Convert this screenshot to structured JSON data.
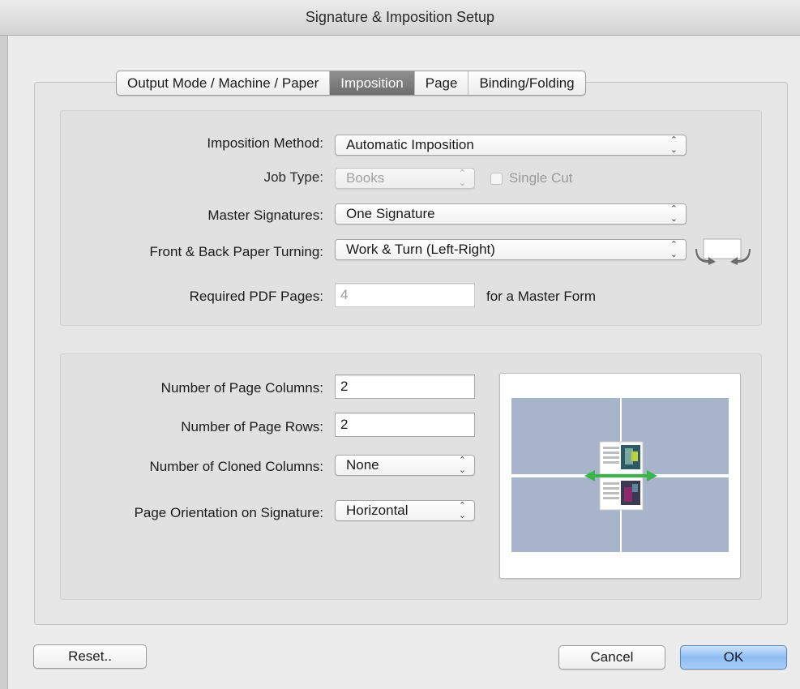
{
  "window": {
    "title": "Signature & Imposition Setup"
  },
  "tabs": [
    {
      "label": "Output Mode / Machine / Paper",
      "active": false
    },
    {
      "label": "Imposition",
      "active": true
    },
    {
      "label": "Page",
      "active": false
    },
    {
      "label": "Binding/Folding",
      "active": false
    }
  ],
  "imposition": {
    "method_label": "Imposition Method:",
    "method_value": "Automatic Imposition",
    "job_type_label": "Job Type:",
    "job_type_value": "Books",
    "single_cut_label": "Single Cut",
    "master_signatures_label": "Master Signatures:",
    "master_signatures_value": "One Signature",
    "paper_turning_label": "Front & Back Paper Turning:",
    "paper_turning_value": "Work & Turn (Left-Right)",
    "required_pages_label": "Required PDF Pages:",
    "required_pages_value": "4",
    "required_pages_suffix": "for a Master Form"
  },
  "layout": {
    "columns_label": "Number of Page Columns:",
    "columns_value": "2",
    "rows_label": "Number of Page Rows:",
    "rows_value": "2",
    "cloned_label": "Number of Cloned Columns:",
    "cloned_value": "None",
    "orientation_label": "Page Orientation on Signature:",
    "orientation_value": "Horizontal"
  },
  "buttons": {
    "reset": "Reset..",
    "cancel": "Cancel",
    "ok": "OK"
  },
  "colors": {
    "sheet": "#a8b4ca",
    "arrow": "#39b54a",
    "ok_button": "#8fbdf3"
  },
  "icons": {
    "turn_icon": "paper-turn-icon",
    "up_down_arrows": "⌃⌄"
  }
}
